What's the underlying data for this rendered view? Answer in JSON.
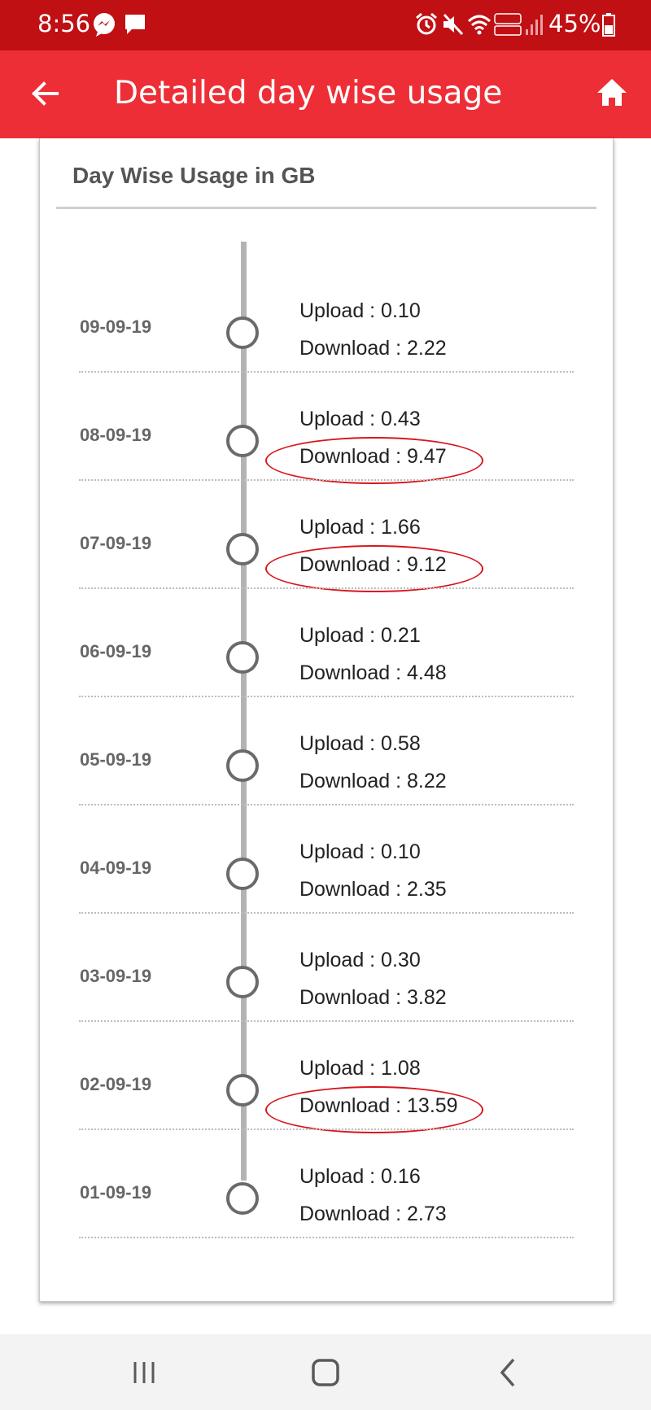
{
  "status_bar": {
    "time": "8:56",
    "battery": "45%",
    "icons": [
      "messenger-icon",
      "message-icon",
      "alarm-icon",
      "mute-icon",
      "wifi-icon",
      "volte-icon",
      "signal-icon",
      "battery-icon"
    ],
    "color": "#c01014"
  },
  "app_bar": {
    "title": "Detailed day wise usage",
    "color": "#ee2e36"
  },
  "card": {
    "title": "Day Wise Usage in GB"
  },
  "days": [
    {
      "date": "09-09-19",
      "upload": "Upload : 0.10",
      "download": "Download : 2.22",
      "highlighted": false
    },
    {
      "date": "08-09-19",
      "upload": "Upload : 0.43",
      "download": "Download : 9.47",
      "highlighted": true
    },
    {
      "date": "07-09-19",
      "upload": "Upload : 1.66",
      "download": "Download : 9.12",
      "highlighted": true
    },
    {
      "date": "06-09-19",
      "upload": "Upload : 0.21",
      "download": "Download : 4.48",
      "highlighted": false
    },
    {
      "date": "05-09-19",
      "upload": "Upload : 0.58",
      "download": "Download : 8.22",
      "highlighted": false
    },
    {
      "date": "04-09-19",
      "upload": "Upload : 0.10",
      "download": "Download : 2.35",
      "highlighted": false
    },
    {
      "date": "03-09-19",
      "upload": "Upload : 0.30",
      "download": "Download : 3.82",
      "highlighted": false
    },
    {
      "date": "02-09-19",
      "upload": "Upload : 1.08",
      "download": "Download : 13.59",
      "highlighted": true
    },
    {
      "date": "01-09-19",
      "upload": "Upload : 0.16",
      "download": "Download : 2.73",
      "highlighted": false
    }
  ],
  "nav_bar": {
    "buttons": [
      "recents-icon",
      "home-nav-icon",
      "back-nav-icon"
    ]
  }
}
